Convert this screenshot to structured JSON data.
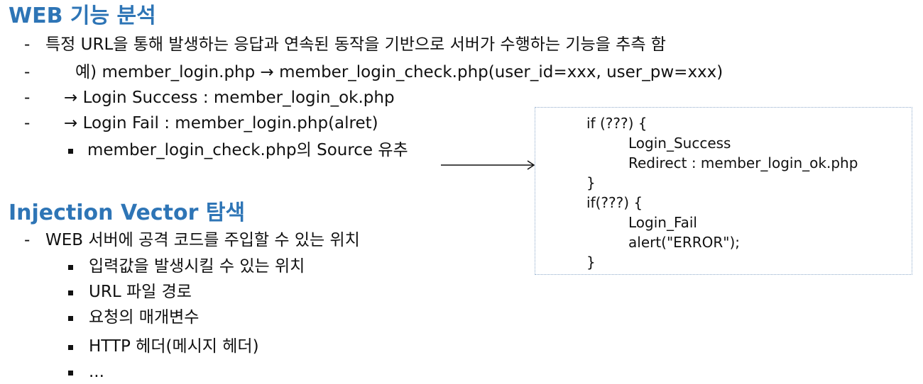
{
  "section1": {
    "title": "WEB 기능 분석",
    "items": [
      {
        "marker": "-",
        "text": "특정 URL을 통해 발생하는 응답과 연속된 동작을 기반으로 서버가 수행하는 기능을 추측 함"
      },
      {
        "marker": "-",
        "text": "예) member_login.php → member_login_check.php(user_id=xxx, user_pw=xxx)"
      },
      {
        "marker": "-",
        "text": "→ Login Success : member_login_ok.php"
      },
      {
        "marker": "-",
        "text": "→ Login Fail : member_login.php(alret)"
      }
    ],
    "sub_items": [
      {
        "marker": "square",
        "text": "member_login_check.php의 Source 유추"
      }
    ]
  },
  "code_box": {
    "lines": [
      "if (???) {",
      "Login_Success",
      "Redirect : member_login_ok.php",
      "}",
      "if(???) {",
      "Login_Fail",
      "alert(\"ERROR\");",
      "}"
    ]
  },
  "section2": {
    "title": "Injection Vector 탐색",
    "items": [
      {
        "marker": "-",
        "text": "WEB 서버에 공격 코드를 주입할 수 있는 위치"
      }
    ],
    "sub_items": [
      {
        "marker": "square",
        "text": "입력값을 발생시킬 수 있는 위치"
      },
      {
        "marker": "square",
        "text": "URL 파일 경로"
      },
      {
        "marker": "square",
        "text": "요청의 매개변수"
      },
      {
        "marker": "square",
        "text": "HTTP 헤더(메시지 헤더)"
      },
      {
        "marker": "square",
        "text": "..."
      }
    ]
  },
  "colors": {
    "heading": "#2e75b6",
    "body_text": "#111111",
    "box_border": "#8eaacb"
  },
  "icons": {
    "arrow": "right-arrow-icon",
    "bullet": "square-bullet-icon"
  }
}
